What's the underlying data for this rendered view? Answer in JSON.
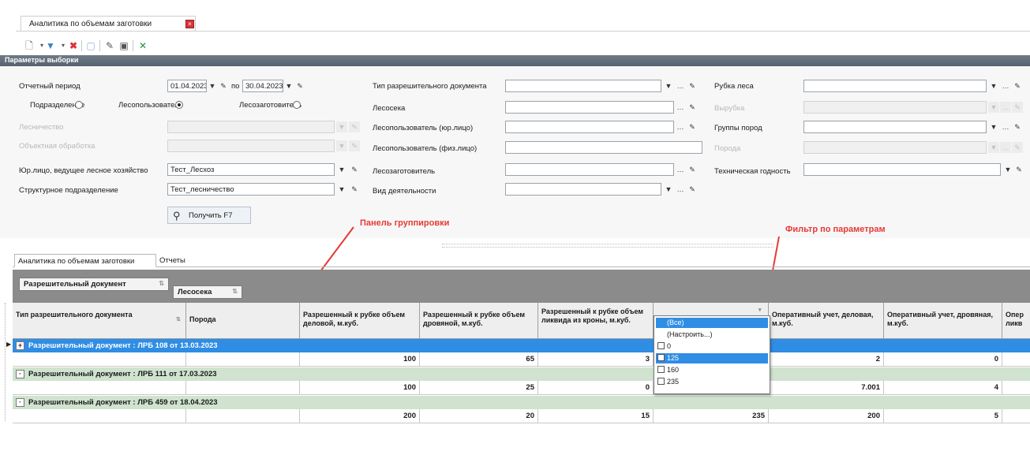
{
  "document_tab": {
    "title": "Аналитика по объемам заготовки",
    "close": "×"
  },
  "params_header": "Параметры выборки",
  "params": {
    "period_label": "Отчетный период",
    "date_from": "01.04.2023",
    "date_to_sep": "по",
    "date_to": "30.04.2023",
    "radio_division": "Подразделение",
    "radio_forest_user": "Лесопользователь",
    "radio_harvester": "Лесозаготовитель",
    "radio_selected": "Лесопользователь",
    "forestry_label": "Лесничество",
    "lease_label": "Объектная обработка",
    "legal_entity_label": "Юр.лицо, ведущее лесное хозяйство",
    "legal_entity_value": "Тест_Лесхоз",
    "struct_unit_label": "Структурное подразделение",
    "struct_unit_value": "Тест_лесничество",
    "permit_type_label": "Тип разрешительного документа",
    "plot_label": "Лесосека",
    "forest_user_ul_label": "Лесопользователь (юр.лицо)",
    "forest_user_fl_label": "Лесопользователь (физ.лицо)",
    "harvester_label": "Лесозаготовитель",
    "activity_label": "Вид деятельности",
    "cutting_label": "Рубка леса",
    "felling_label": "Вырубка",
    "species_group_label": "Группы пород",
    "species_label": "Порода",
    "tech_label": "Техническая годность",
    "get_button": "Получить F7"
  },
  "annotations": {
    "grouping": "Панель группировки",
    "filter": "Фильтр по параметрам"
  },
  "bottom_tabs": [
    "Аналитика по объемам заготовки",
    "Отчеты"
  ],
  "group_chips": [
    "Разрешительный документ",
    "Лесосека"
  ],
  "columns": [
    "Тип разрешительного документа",
    "Порода",
    "Разрешенный к рубке объем деловой, м.куб.",
    "Разрешенный к рубке объем дровяной, м.куб.",
    "Разрешенный к рубке объем ликвида из кроны, м.куб.",
    "",
    "Оперативный учет, деловая, м.куб.",
    "Оперативный учет, дровяная, м.куб.",
    "Опер ликв"
  ],
  "groups": [
    {
      "title": "Разрешительный документ : ЛРБ 108 от 13.03.2023",
      "values": [
        "100",
        "65",
        "3",
        "",
        "2",
        "0"
      ]
    },
    {
      "title": "Разрешительный документ : ЛРБ 111 от 17.03.2023",
      "values": [
        "100",
        "25",
        "0",
        "125",
        "7.001",
        "4"
      ]
    },
    {
      "title": "Разрешительный документ : ЛРБ 459 от 18.04.2023",
      "values": [
        "200",
        "20",
        "15",
        "235",
        "200",
        "5"
      ]
    }
  ],
  "filter_popup": [
    "(Все)",
    "(Настроить...)",
    "0",
    "125",
    "160",
    "235"
  ],
  "colors": {
    "selection": "#2f8de4",
    "group_row": "#cfe3cf",
    "header_bar": "#566270",
    "annotation": "#e53a36"
  }
}
